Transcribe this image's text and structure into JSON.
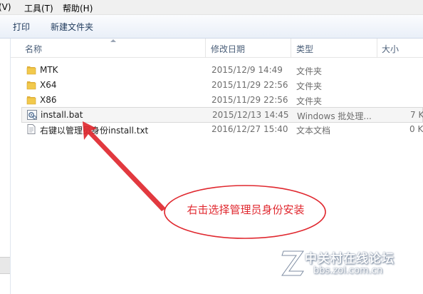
{
  "menu": {
    "view": "(V)",
    "tools": "工具(T)",
    "help": "帮助(H)"
  },
  "toolbar": {
    "print": "打印",
    "new_folder": "新建文件夹"
  },
  "columns": {
    "name": "名称",
    "modified": "修改日期",
    "type": "类型",
    "size": "大小"
  },
  "files": [
    {
      "name": "MTK",
      "modified": "2015/12/9 14:49",
      "type": "文件夹",
      "size": "",
      "icon": "folder-icon"
    },
    {
      "name": "X64",
      "modified": "2015/11/29 22:56",
      "type": "文件夹",
      "size": "",
      "icon": "folder-icon"
    },
    {
      "name": "X86",
      "modified": "2015/11/29 22:56",
      "type": "文件夹",
      "size": "",
      "icon": "folder-icon"
    },
    {
      "name": "install.bat",
      "modified": "2015/12/13 14:45",
      "type": "Windows 批处理...",
      "size": "7 K",
      "icon": "batch-file-icon"
    },
    {
      "name": "右键以管理员身份install.txt",
      "modified": "2016/12/27 15:40",
      "type": "文本文档",
      "size": "0 K",
      "icon": "text-file-icon"
    }
  ],
  "annotation": {
    "text": "右击选择管理员身份安装",
    "color": "#e0282f"
  },
  "watermark": {
    "site_name": "中关村在线论坛",
    "url": "bbs.zol.com.cn"
  }
}
